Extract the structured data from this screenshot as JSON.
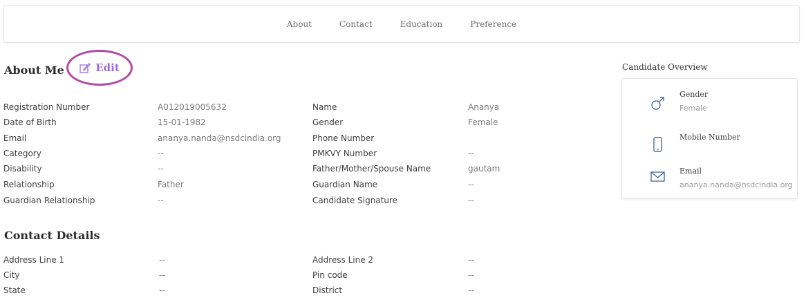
{
  "nav": {
    "items": [
      "About",
      "Contact",
      "Education",
      "Preference"
    ]
  },
  "about": {
    "title": "About Me",
    "edit_label": "Edit",
    "left_fields": [
      {
        "label": "Registration Number",
        "value": "A012019005632"
      },
      {
        "label": "Date of Birth",
        "value": "15-01-1982"
      },
      {
        "label": "Email",
        "value": "ananya.nanda@nsdcindia.org"
      },
      {
        "label": "Category",
        "value": "--"
      },
      {
        "label": "Disability",
        "value": "--"
      },
      {
        "label": "Relationship",
        "value": "Father"
      },
      {
        "label": "Guardian Relationship",
        "value": "--"
      }
    ],
    "right_fields": [
      {
        "label": "Name",
        "value": "Ananya"
      },
      {
        "label": "Gender",
        "value": "Female"
      },
      {
        "label": "Phone Number",
        "value": ""
      },
      {
        "label": "PMKVY Number",
        "value": "--"
      },
      {
        "label": "Father/Mother/Spouse Name",
        "value": "gautam"
      },
      {
        "label": "Guardian Name",
        "value": "--"
      },
      {
        "label": "Candidate Signature",
        "value": "--"
      }
    ]
  },
  "contact": {
    "title": "Contact Details",
    "left_fields": [
      {
        "label": "Address Line 1",
        "value": "--"
      },
      {
        "label": "City",
        "value": "--"
      },
      {
        "label": "State",
        "value": "--"
      }
    ],
    "right_fields": [
      {
        "label": "Address Line 2",
        "value": "--"
      },
      {
        "label": "Pin code",
        "value": "--"
      },
      {
        "label": "District",
        "value": "--"
      }
    ]
  },
  "overview": {
    "title": "Candidate Overview",
    "items": [
      {
        "icon": "gender-male-icon",
        "label": "Gender",
        "value": "Female"
      },
      {
        "icon": "mobile-phone-icon",
        "label": "Mobile Number",
        "value": ""
      },
      {
        "icon": "envelope-icon",
        "label": "Email",
        "value": "ananya.nanda@nsdcindia.org"
      }
    ]
  },
  "colors": {
    "edit_text": "#9b6fd0",
    "edit_circle": "#b04aa6",
    "icon": "#4a6fa5"
  }
}
